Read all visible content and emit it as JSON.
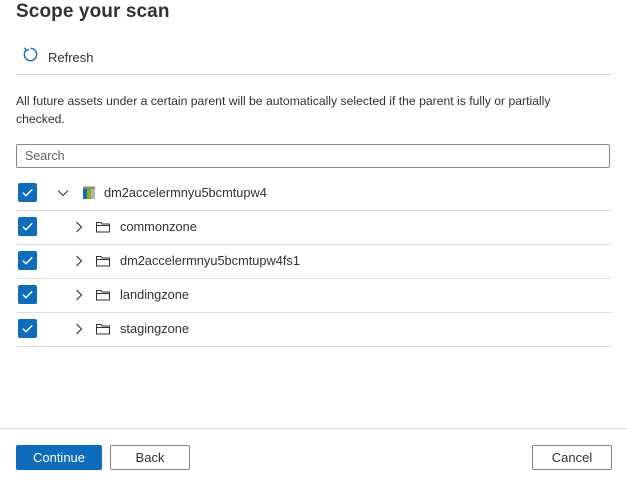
{
  "title": "Scope your scan",
  "toolbar": {
    "refresh_label": "Refresh"
  },
  "info_text": "All future assets under a certain parent will be automatically selected if the parent is fully or partially checked.",
  "search": {
    "placeholder": "Search",
    "value": ""
  },
  "tree": {
    "root": {
      "label": "dm2accelermnyu5bcmtupw4",
      "checked": true,
      "expanded": true,
      "icon": "storage-account-icon"
    },
    "children": [
      {
        "label": "commonzone",
        "checked": true,
        "expanded": false,
        "icon": "folder-icon"
      },
      {
        "label": "dm2accelermnyu5bcmtupw4fs1",
        "checked": true,
        "expanded": false,
        "icon": "folder-icon"
      },
      {
        "label": "landingzone",
        "checked": true,
        "expanded": false,
        "icon": "folder-icon"
      },
      {
        "label": "stagingzone",
        "checked": true,
        "expanded": false,
        "icon": "folder-icon"
      }
    ]
  },
  "footer": {
    "continue_label": "Continue",
    "back_label": "Back",
    "cancel_label": "Cancel"
  },
  "colors": {
    "accent": "#0f6cbd",
    "text": "#323130",
    "border": "#8a8886",
    "divider": "#e1dfdd"
  }
}
